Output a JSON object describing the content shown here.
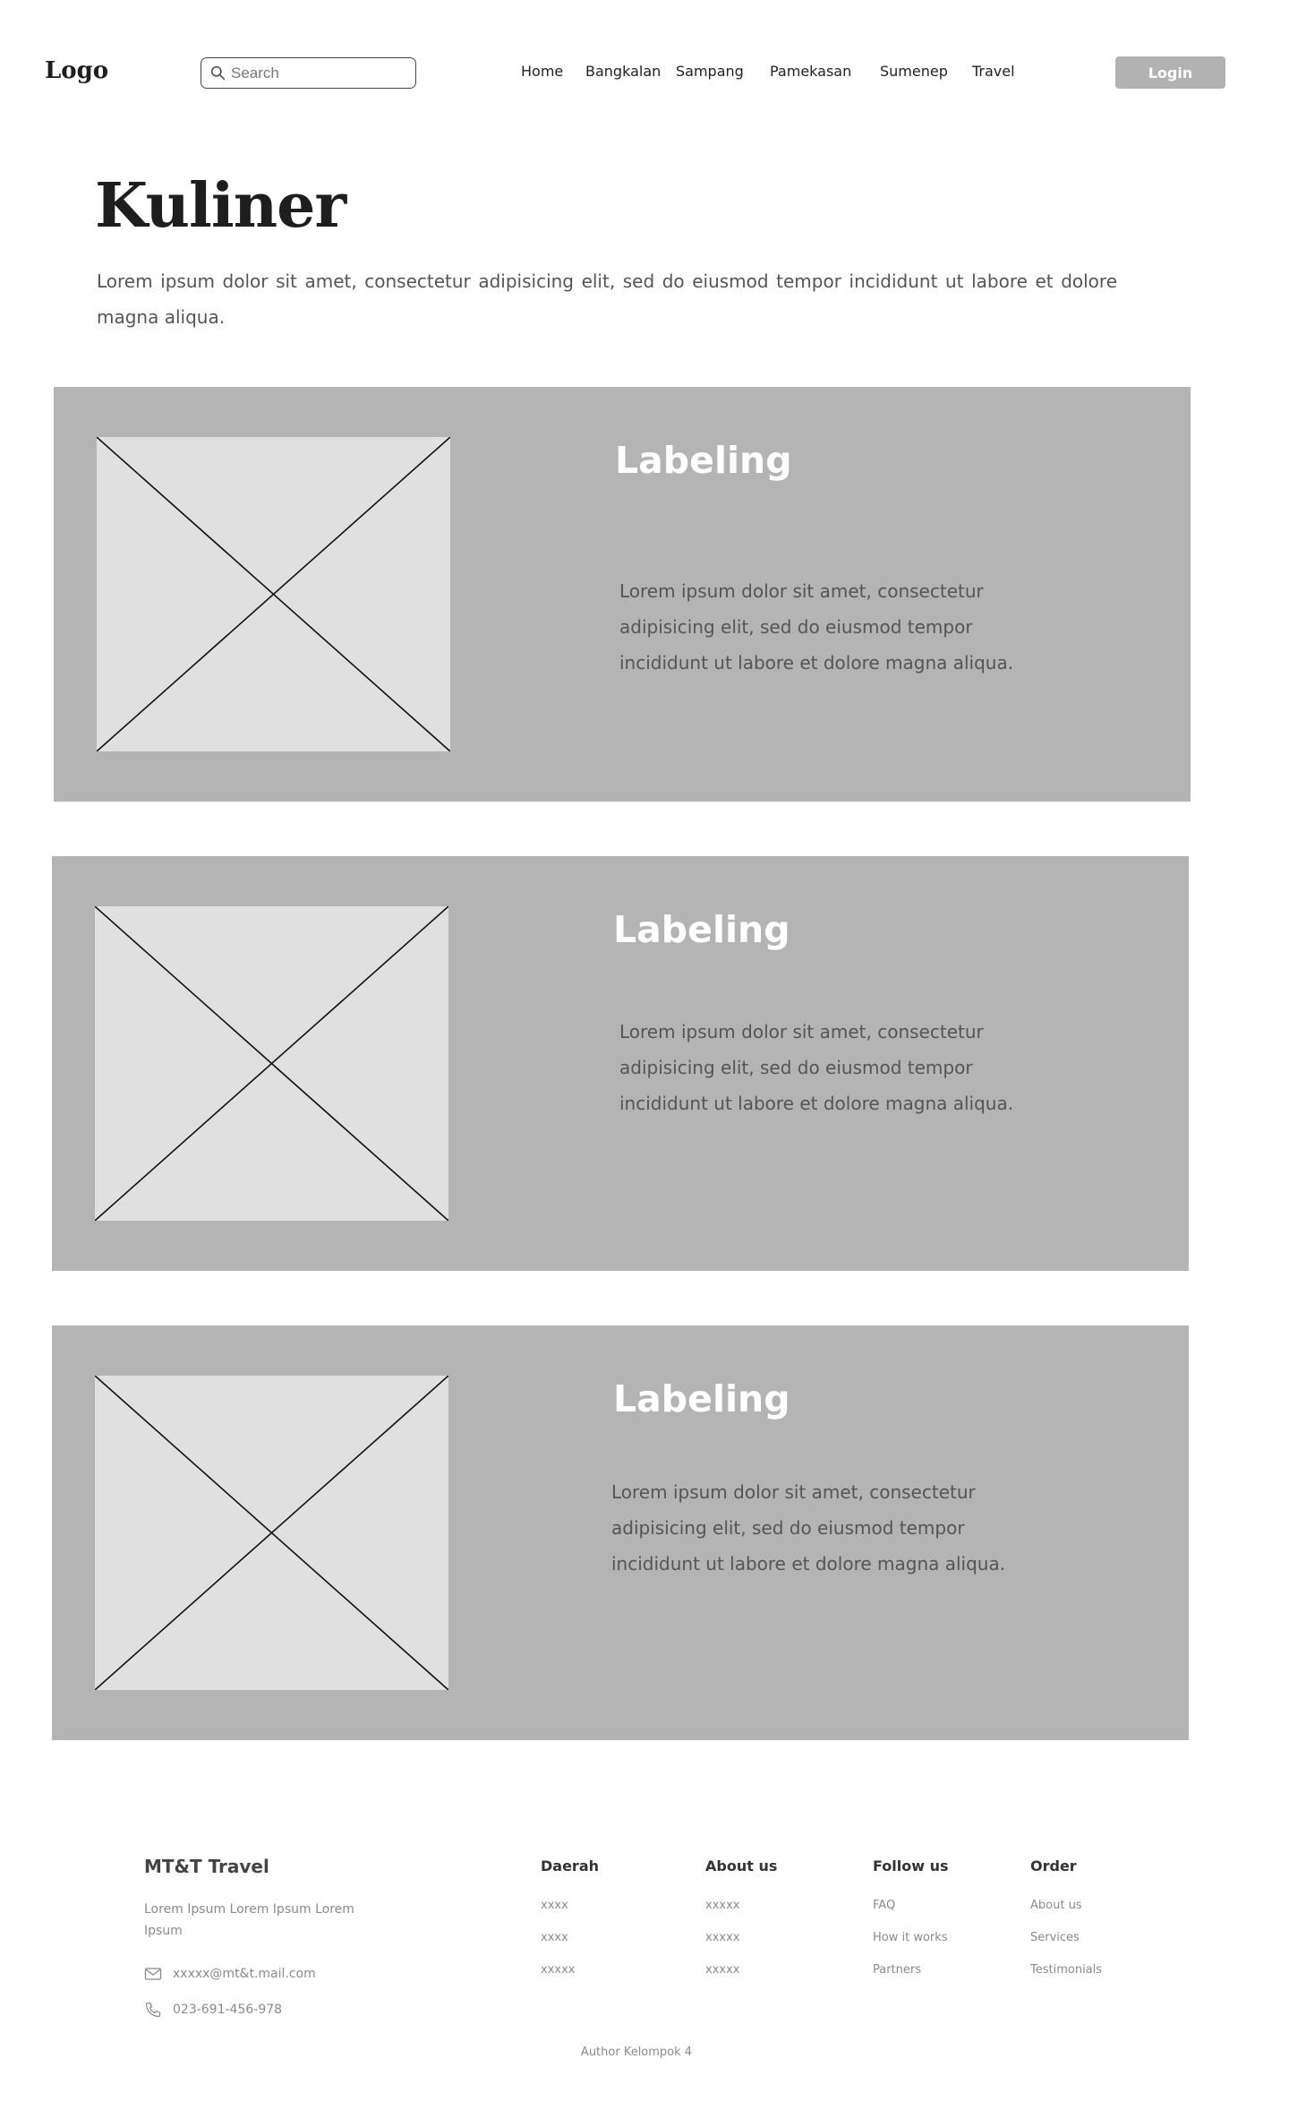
{
  "header": {
    "logo": "Logo",
    "search": {
      "placeholder": "Search",
      "value": ""
    },
    "nav": [
      {
        "label": "Home"
      },
      {
        "label": "Bangkalan"
      },
      {
        "label": "Sampang"
      },
      {
        "label": "Pamekasan"
      },
      {
        "label": "Sumenep"
      },
      {
        "label": "Travel"
      }
    ],
    "login_label": "Login"
  },
  "hero": {
    "title": "Kuliner",
    "description": "Lorem ipsum dolor sit amet, consectetur adipisicing elit, sed do eiusmod tempor incididunt ut labore et dolore magna aliqua."
  },
  "cards": [
    {
      "label": "Labeling",
      "description": "Lorem ipsum dolor sit amet, consectetur adipisicing elit, sed do eiusmod tempor incididunt ut labore et dolore magna aliqua."
    },
    {
      "label": "Labeling",
      "description": "Lorem ipsum dolor sit amet, consectetur adipisicing elit, sed do eiusmod tempor incididunt ut labore et dolore magna aliqua."
    },
    {
      "label": "Labeling",
      "description": "Lorem ipsum dolor sit amet, consectetur adipisicing elit, sed do eiusmod tempor incididunt ut labore et dolore magna aliqua."
    }
  ],
  "footer": {
    "brand": "MT&T Travel",
    "about": "Lorem Ipsum  Lorem Ipsum Lorem Ipsum",
    "email": "xxxxx@mt&t.mail.com",
    "phone": "023-691-456-978",
    "columns": [
      {
        "heading": "Daerah",
        "links": [
          "xxxx",
          "xxxx",
          "xxxxx"
        ]
      },
      {
        "heading": "About us",
        "links": [
          "xxxxx",
          "xxxxx",
          "xxxxx"
        ]
      },
      {
        "heading": "Follow us",
        "links": [
          "FAQ",
          "How it works",
          "Partners"
        ]
      },
      {
        "heading": "Order",
        "links": [
          "About us",
          "Services",
          "Testimonials"
        ]
      }
    ],
    "author": "Author Kelompok 4"
  },
  "colors": {
    "card_background": "#b4b4b4",
    "image_placeholder": "#e0e0e0",
    "login_button": "#b2b2b2",
    "heading_text": "#1e1e1e",
    "muted_text": "#8a8a8a"
  },
  "icons": {
    "search": "search-icon",
    "email": "mail-icon",
    "phone": "phone-icon",
    "image_placeholder": "image-placeholder-icon"
  }
}
